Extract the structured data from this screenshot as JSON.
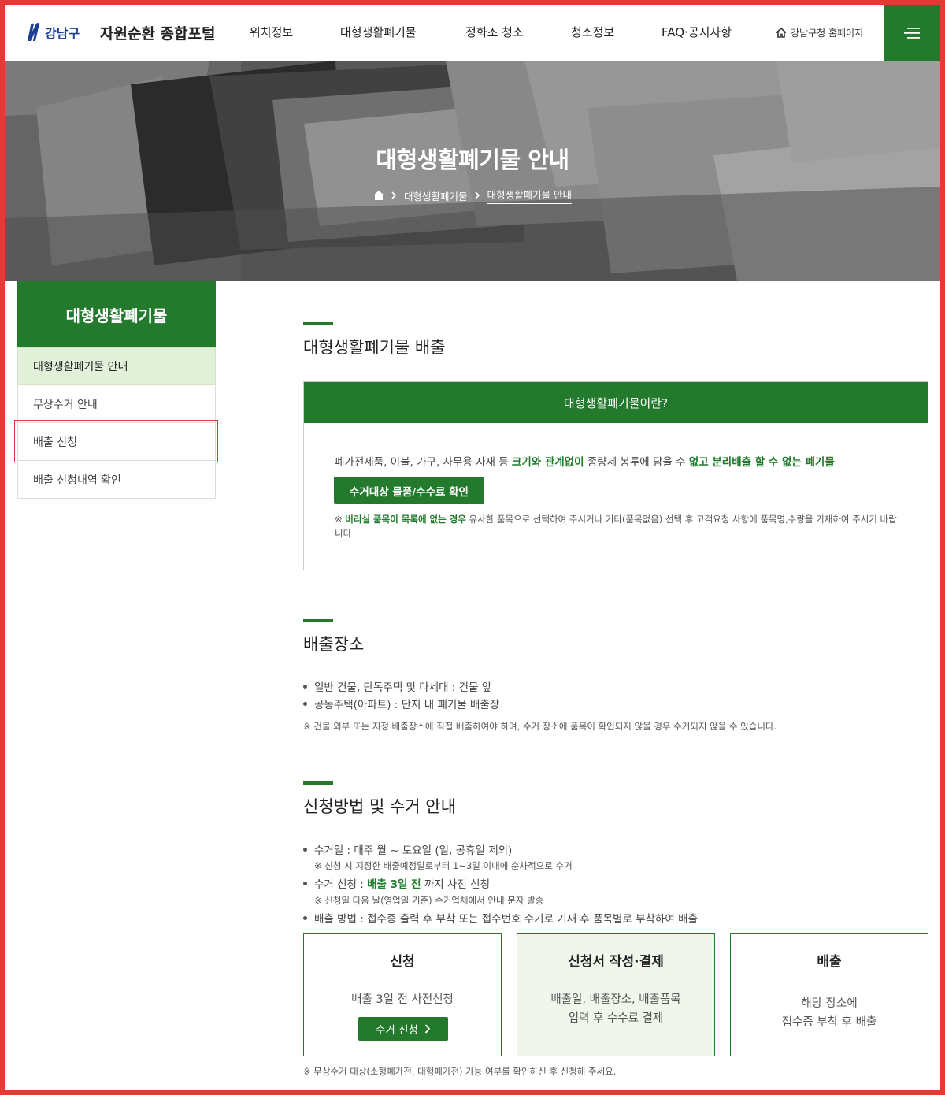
{
  "header": {
    "logo_text": "강남구",
    "portal_title": "자원순환 종합포털",
    "nav": [
      "위치정보",
      "대형생활폐기물",
      "정화조 청소",
      "청소정보",
      "FAQ·공지사항"
    ],
    "home_link": "강남구청 홈페이지"
  },
  "hero": {
    "title": "대형생활폐기물 안내",
    "breadcrumb": [
      "대형생활폐기물",
      "대형생활폐기물 안내"
    ]
  },
  "sidebar": {
    "title": "대형생활폐기물",
    "items": [
      "대형생활폐기물 안내",
      "무상수거 안내",
      "배출 신청",
      "배출 신청내역 확인"
    ],
    "active_index": 0
  },
  "section1": {
    "title": "대형생활폐기물 배출",
    "box_title": "대형생활폐기물이란?",
    "desc_1": "폐가전제품, 이불, 가구, 사무용 자재 등 ",
    "desc_bold_1": "크기와 관계없이",
    "desc_2": " 종량제 봉투에 담을 수 ",
    "desc_bold_2": "없고 분리배출 할 수 없는 폐기물",
    "button": "수거대상 물품/수수료 확인",
    "note_prefix": "※ ",
    "note_bold": "버리실 품목이 목록에 없는 경우",
    "note_rest": " 유사한 품목으로 선택하여 주시거나 기타(품목없음) 선택 후 고객요청 사항에 품목명,수량을 기재하여 주시기 바랍니다"
  },
  "section2": {
    "title": "배출장소",
    "bullets": [
      "일반 건물, 단독주택 및 다세대 : 건물 앞",
      "공동주택(아파트) : 단지 내 폐기물 배출장"
    ],
    "note": "※ 건물 외부 또는 지정 배출장소에 직접 배출하여야 하며, 수거 장소에 품목이 확인되지 않을 경우 수거되지 않을 수 있습니다."
  },
  "section3": {
    "title": "신청방법 및 수거 안내",
    "b1": "수거일 : 매주 월 ~ 토요일 (일, 공휴일 제외)",
    "b1_note": "※ 신청 시 지정한 배출예정일로부터 1~3일 이내에 순차적으로 수거",
    "b2_pre": "수거 신청 : ",
    "b2_bold": "배출 3일 전",
    "b2_post": " 까지 사전 신청",
    "b2_note": "※ 신청일 다음 날(영업일 기준) 수거업체에서 안내 문자 발송",
    "b3": "배출 방법 : 접수증 출력 후 부착 또는 접수번호 수기로 기재 후 품목별로 부착하여 배출",
    "steps": [
      {
        "title": "신청",
        "desc1": "배출 3일 전 사전신청",
        "button": "수거 신청"
      },
      {
        "title": "신청서 작성·결제",
        "desc1": "배출일, 배출장소, 배출품목",
        "desc2": "입력 후 수수료 결제"
      },
      {
        "title": "배출",
        "desc1": "해당 장소에",
        "desc2": "접수증 부착 후 배출"
      }
    ],
    "footnote": "※ 무상수거 대상(소형폐가전, 대형폐가전) 가능 여부를 확인하신 후 신청해 주세요."
  },
  "colors": {
    "brand_green": "#23792c",
    "active_bg": "#e2efd9",
    "highlight": "#e53935"
  },
  "icons": {
    "home": "home-icon",
    "menu": "hamburger-menu-icon",
    "chevron": "chevron-right-icon"
  }
}
